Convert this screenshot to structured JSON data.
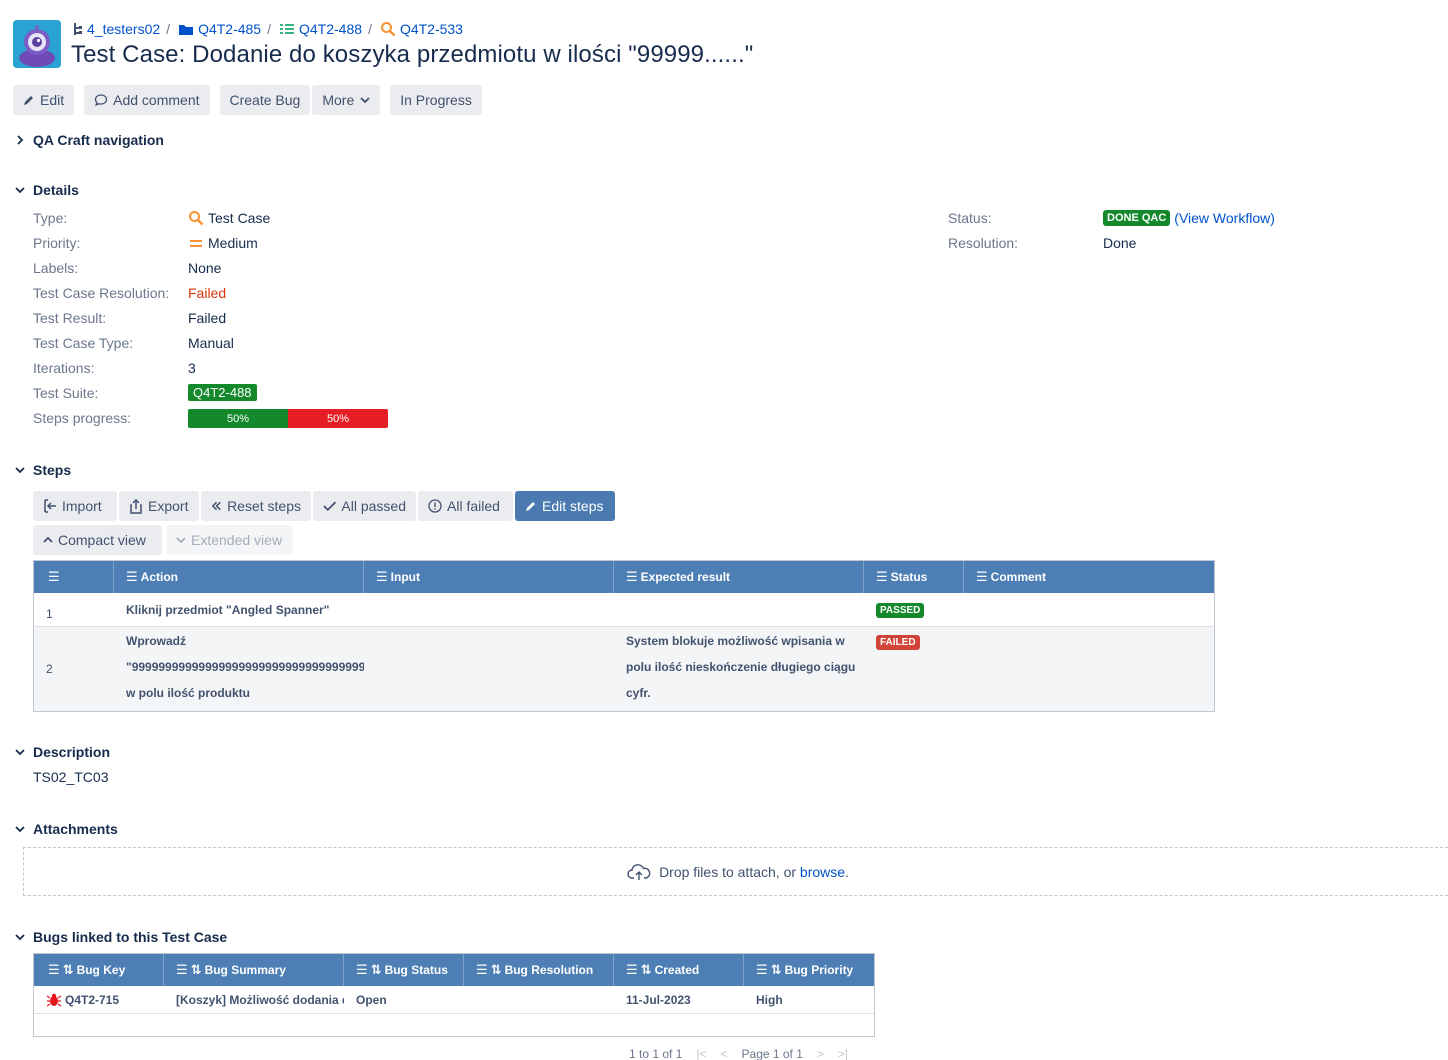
{
  "breadcrumbs": [
    {
      "label": "4_testers02",
      "icon": "project-tree-icon"
    },
    {
      "label": "Q4T2-485",
      "icon": "folder-icon"
    },
    {
      "label": "Q4T2-488",
      "icon": "list-icon"
    },
    {
      "label": "Q4T2-533",
      "icon": "test-case-icon"
    }
  ],
  "issue": {
    "title_prefix": "Test Case:",
    "title": "Dodanie do koszyka przedmiotu w ilości \"99999......\""
  },
  "toolbar": {
    "edit": "Edit",
    "add_comment": "Add comment",
    "create_bug": "Create Bug",
    "more": "More",
    "in_progress": "In Progress"
  },
  "sections": {
    "qa_nav": "QA Craft navigation",
    "details": "Details",
    "steps": "Steps",
    "description": "Description",
    "attachments": "Attachments",
    "bugs": "Bugs linked to this Test Case"
  },
  "details": {
    "type_label": "Type:",
    "type_value": "Test Case",
    "priority_label": "Priority:",
    "priority_value": "Medium",
    "labels_label": "Labels:",
    "labels_value": "None",
    "resolution_label": "Test Case Resolution:",
    "resolution_value": "Failed",
    "result_label": "Test Result:",
    "result_value": "Failed",
    "case_type_label": "Test Case Type:",
    "case_type_value": "Manual",
    "iterations_label": "Iterations:",
    "iterations_value": "3",
    "suite_label": "Test Suite:",
    "suite_value": "Q4T2-488",
    "progress_label": "Steps progress:",
    "progress_pass": "50%",
    "progress_fail": "50%",
    "progress_pass_fraction": 0.5,
    "status_label": "Status:",
    "status_value": "DONE QAC",
    "status_link": "(View Workflow)",
    "res_label": "Resolution:",
    "res_value": "Done"
  },
  "steps_toolbar": {
    "import": "Import",
    "export": "Export",
    "reset": "Reset steps",
    "all_passed": "All passed",
    "all_failed": "All failed",
    "edit_steps": "Edit steps",
    "compact": "Compact view",
    "extended": "Extended view"
  },
  "steps_table": {
    "headers": [
      "",
      "Action",
      "Input",
      "Expected result",
      "Status",
      "Comment"
    ],
    "rows": [
      {
        "num": "1",
        "action": "Kliknij przedmiot \"Angled Spanner\"",
        "input": "",
        "expected": "",
        "status": "PASSED",
        "comment": ""
      },
      {
        "num": "2",
        "action_lines": [
          "Wprowadź",
          "\"99999999999999999999999999999999999999",
          "w polu ilość produktu"
        ],
        "input": "",
        "expected_lines": [
          "System blokuje możliwość wpisania w",
          "polu ilość nieskończenie długiego ciągu",
          "cyfr."
        ],
        "status": "FAILED",
        "comment": ""
      }
    ]
  },
  "description": {
    "text": "TS02_TC03"
  },
  "attachments": {
    "drop_text": "Drop files to attach, or",
    "browse": "browse",
    "period": "."
  },
  "bugs_table": {
    "headers": [
      "Bug Key",
      "Bug Summary",
      "Bug Status",
      "Bug Resolution",
      "Created",
      "Bug Priority"
    ],
    "rows": [
      {
        "key": "Q4T2-715",
        "summary": "[Koszyk] Możliwość dodania do",
        "status": "Open",
        "resolution": "",
        "created": "11-Jul-2023",
        "priority": "High"
      }
    ]
  },
  "pager": {
    "range": "1 to 1 of 1",
    "page": "Page 1 of 1"
  },
  "colors": {
    "header_blue": "#4d7fb4",
    "pass_green": "#14892c",
    "fail_red": "#e51e25",
    "link": "#0052cc"
  }
}
